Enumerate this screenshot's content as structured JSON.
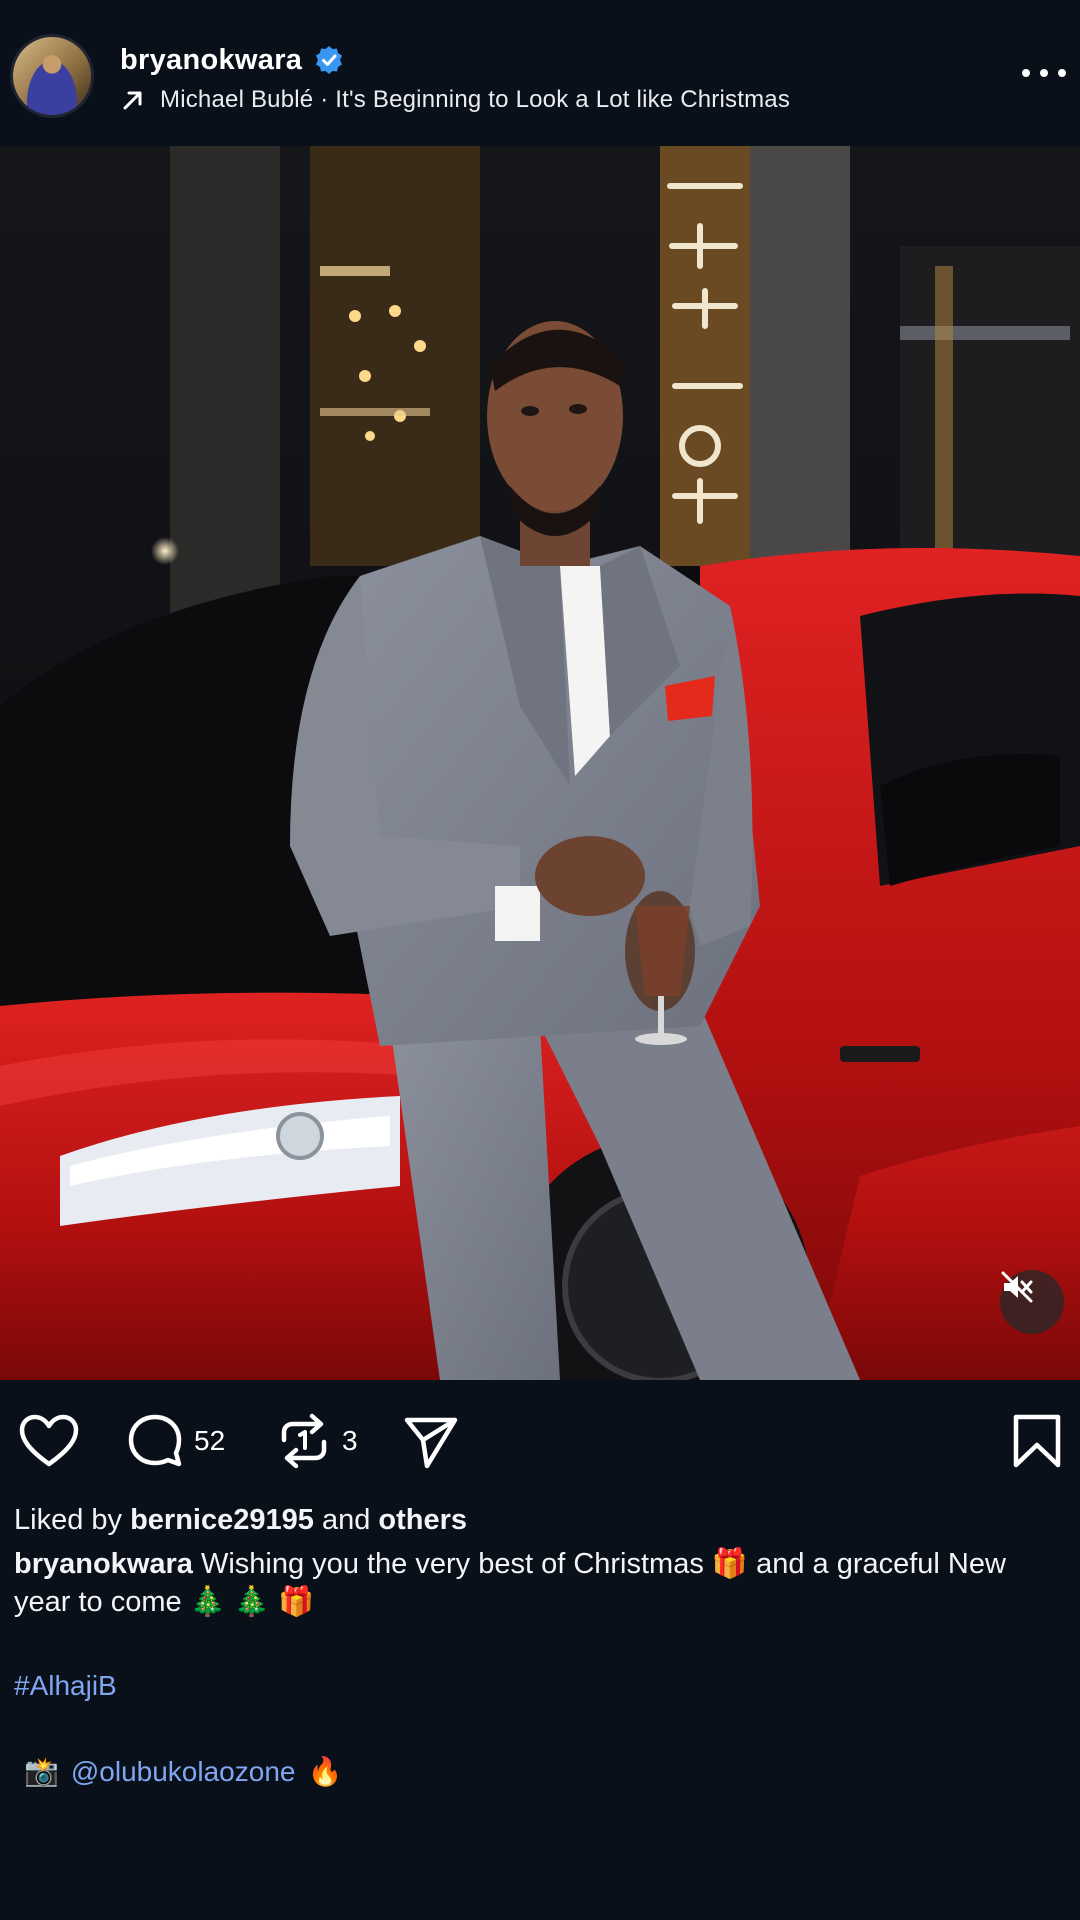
{
  "post": {
    "username": "bryanokwara",
    "verified": true,
    "music": "Michael Bublé · It's Beginning to Look a Lot like Christmas"
  },
  "icons": {
    "verified": "verified-badge-icon",
    "music": "arrow-up-right-icon",
    "more": "more-dots-icon",
    "mute": "speaker-muted-icon",
    "like": "heart-icon",
    "comment": "comment-bubble-icon",
    "repost": "repost-icon",
    "share": "send-icon",
    "save": "bookmark-icon",
    "camera": "camera-flash-emoji",
    "fire": "fire-emoji",
    "gift": "gift-emoji",
    "tree": "christmas-tree-emoji"
  },
  "counts": {
    "comments": "52",
    "reposts": "3"
  },
  "likes": {
    "prefix": "Liked by",
    "user": "bernice29195",
    "middle": "and",
    "others": "others"
  },
  "caption": {
    "author": "bryanokwara",
    "text_part1": "Wishing you the very best of Christmas",
    "gift_emoji": "🎁",
    "text_part2": "and a graceful New year to come",
    "tree_emoji": "🎄",
    "hashtag": "#AlhajiB",
    "camera_emoji": "📸",
    "mention": "@olubukolaozone",
    "fire_emoji": "🔥"
  },
  "colors": {
    "background": "#0a101a",
    "link": "#7fa6f0",
    "verified": "#3897f0",
    "car_red": "#c41515",
    "suit_gray": "#7d8290"
  }
}
